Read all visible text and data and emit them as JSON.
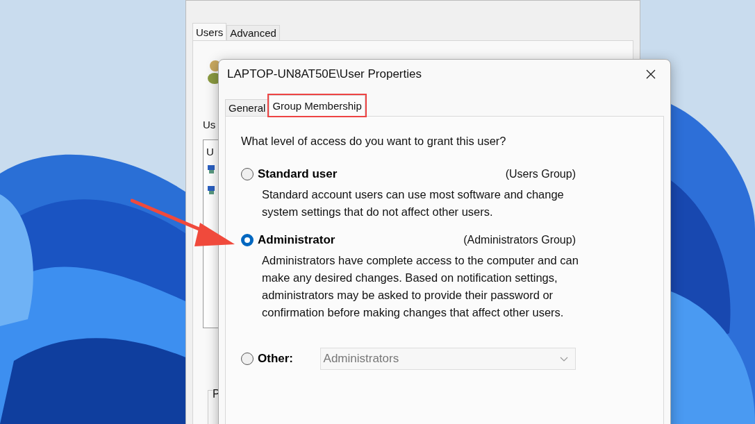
{
  "background_window": {
    "tabs": [
      {
        "label": "Users",
        "selected": true
      },
      {
        "label": "Advanced",
        "selected": false
      }
    ],
    "label_cut": "Us",
    "list_header_cut": "U",
    "group_label_cut": "P"
  },
  "dialog": {
    "title": "LAPTOP-UN8AT50E\\User Properties",
    "tabs": [
      {
        "label": "General",
        "selected": false,
        "highlighted": false
      },
      {
        "label": "Group Membership",
        "selected": true,
        "highlighted": true
      }
    ],
    "question": "What level of access do you want to grant this user?",
    "options": [
      {
        "kind": "radio",
        "label": "Standard user",
        "group": "(Users Group)",
        "description": "Standard account users can use most software and change system settings that do not affect other users.",
        "selected": false
      },
      {
        "kind": "radio",
        "label": "Administrator",
        "group": "(Administrators Group)",
        "description": "Administrators have complete access to the computer and can make any desired changes. Based on notification settings, administrators may be asked to provide their password or confirmation before making changes that affect other users.",
        "selected": true
      },
      {
        "kind": "combo",
        "label": "Other:",
        "value": "Administrators",
        "disabled": true,
        "selected": false
      }
    ]
  }
}
